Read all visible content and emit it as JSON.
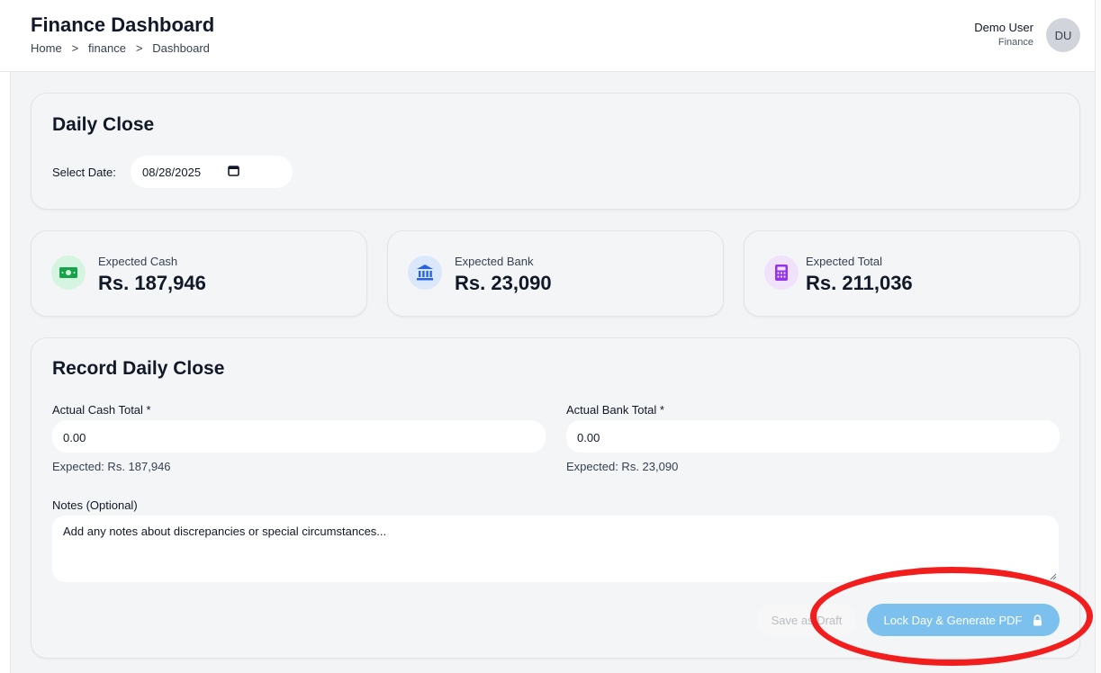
{
  "header": {
    "title": "Finance Dashboard",
    "breadcrumb": [
      "Home",
      ">",
      "finance",
      ">",
      "Dashboard"
    ],
    "user": {
      "name": "Demo User",
      "role": "Finance",
      "initials": "DU"
    }
  },
  "daily_close": {
    "title": "Daily Close",
    "date_label": "Select Date:",
    "date_value": "08/28/2025",
    "date_icon": "calendar-icon"
  },
  "stats": [
    {
      "label": "Expected Cash",
      "value": "Rs. 187,946",
      "icon": "cash-icon",
      "color": "#16a34a",
      "bg": "#d6f5e0"
    },
    {
      "label": "Expected Bank",
      "value": "Rs. 23,090",
      "icon": "bank-icon",
      "color": "#2563eb",
      "bg": "#dbe7fb"
    },
    {
      "label": "Expected Total",
      "value": "Rs. 211,036",
      "icon": "calculator-icon",
      "color": "#9333ea",
      "bg": "#f1e2fb"
    }
  ],
  "record": {
    "title": "Record Daily Close",
    "cash": {
      "label": "Actual Cash Total *",
      "value": "0.00",
      "hint": "Expected: Rs. 187,946"
    },
    "bank": {
      "label": "Actual Bank Total *",
      "value": "0.00",
      "hint": "Expected: Rs. 23,090"
    },
    "notes": {
      "label": "Notes (Optional)",
      "placeholder": "Add any notes about discrepancies or special circumstances..."
    },
    "save_draft": "Save as Draft",
    "lock_button": "Lock Day & Generate PDF",
    "lock_icon": "lock-icon"
  },
  "annotation": {
    "shape": "ellipse",
    "color": "#f21d1d"
  }
}
